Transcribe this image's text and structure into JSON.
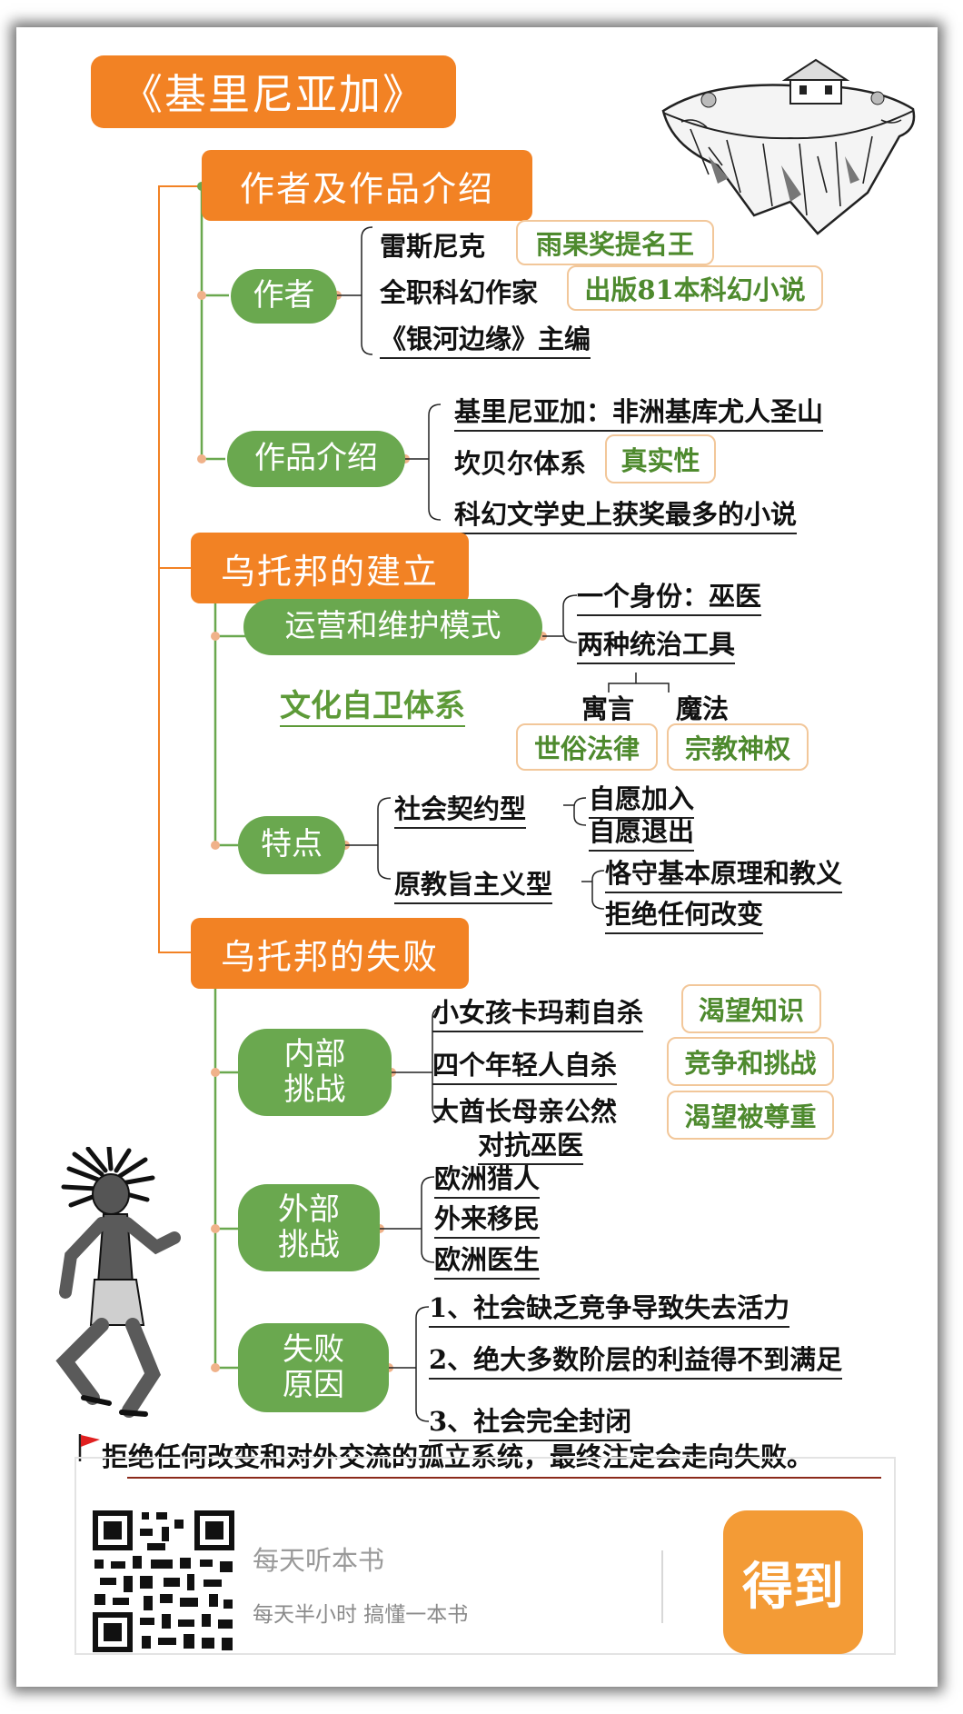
{
  "title": "《基里尼亚加》",
  "sections": {
    "intro": {
      "label": "作者及作品介绍",
      "author": {
        "label": "作者",
        "items": [
          {
            "text": "雷斯尼克",
            "tag": "雨果奖提名王"
          },
          {
            "text": "全职科幻作家",
            "tag": "出版81本科幻小说"
          },
          {
            "text": "《银河边缘》主编"
          }
        ]
      },
      "work": {
        "label": "作品介绍",
        "items": [
          {
            "text": "基里尼亚加：非洲基库尤人圣山"
          },
          {
            "text": "坎贝尔体系",
            "tag": "真实性"
          },
          {
            "text": "科幻文学史上获奖最多的小说"
          }
        ]
      }
    },
    "founding": {
      "label": "乌托邦的建立",
      "ops": {
        "label": "运营和维护模式",
        "items": [
          "一个身份：巫医",
          "两种统治工具"
        ],
        "tools": [
          {
            "name": "寓言",
            "tag": "世俗法律"
          },
          {
            "name": "魔法",
            "tag": "宗教神权"
          }
        ]
      },
      "culture": "文化自卫体系",
      "traits": {
        "label": "特点",
        "groups": [
          {
            "name": "社会契约型",
            "items": [
              "自愿加入",
              "自愿退出"
            ]
          },
          {
            "name": "原教旨主义型",
            "items": [
              "恪守基本原理和教义",
              "拒绝任何改变"
            ]
          }
        ]
      }
    },
    "failure": {
      "label": "乌托邦的失败",
      "internal": {
        "label_line1": "内部",
        "label_line2": "挑战",
        "items": [
          {
            "text": "小女孩卡玛莉自杀",
            "tag": "渴望知识"
          },
          {
            "text": "四个年轻人自杀",
            "tag": "竞争和挑战"
          },
          {
            "text_line1": "大酋长母亲公然",
            "text_line2": "对抗巫医",
            "tag": "渴望被尊重"
          }
        ]
      },
      "external": {
        "label_line1": "外部",
        "label_line2": "挑战",
        "items": [
          "欧洲猎人",
          "外来移民",
          "欧洲医生"
        ]
      },
      "reasons": {
        "label_line1": "失败",
        "label_line2": "原因",
        "items": [
          "1、社会缺乏竞争导致失去活力",
          "2、绝大多数阶层的利益得不到满足",
          "3、社会完全封闭"
        ]
      }
    }
  },
  "conclusion": "拒绝任何改变和对外交流的孤立系统，最终注定会走向失败。",
  "footer": {
    "brand_name": "每天听本书",
    "slogan": "每天半小时  搞懂一本书",
    "app_logo": "得到"
  },
  "colors": {
    "section": "#f28224",
    "pill": "#6aa84f",
    "tag_text": "#4e8a2e",
    "tag_border": "#f2c79a",
    "footer_logo": "#f39b36"
  },
  "icons": [
    "floating-island-illustration",
    "tribal-runner-illustration",
    "red-flag-icon",
    "qr-code"
  ]
}
